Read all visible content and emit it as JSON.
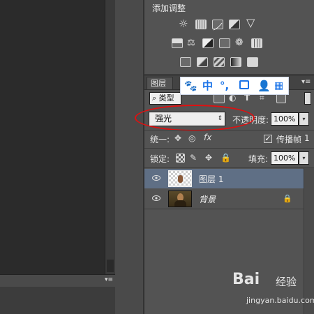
{
  "adjustments": {
    "title": "添加调整",
    "icons": [
      "brightness-contrast-icon",
      "levels-icon",
      "curves-icon",
      "exposure-icon",
      "vibrance-icon",
      "hue-saturation-icon",
      "color-balance-icon",
      "black-white-icon",
      "photo-filter-icon",
      "channel-mixer-icon",
      "color-lookup-icon",
      "invert-icon",
      "posterize-icon",
      "threshold-icon",
      "gradient-map-icon",
      "selective-color-icon"
    ]
  },
  "layers_panel": {
    "tab_label": "图层",
    "filter_label": "类型",
    "blend_mode": "强光",
    "opacity_label": "不透明度:",
    "opacity_value": "100%",
    "unify_label": "统一:",
    "propagate_label": "传播帧",
    "frame_number": "1",
    "lock_label": "锁定:",
    "fill_label": "填充:",
    "fill_value": "100%",
    "layers": [
      {
        "name": "图层 1",
        "selected": true
      },
      {
        "name": "背景",
        "selected": false
      }
    ]
  },
  "ime_toolbar": {
    "icons": [
      "paw-icon",
      "chinese-mode-icon",
      "punctuation-icon",
      "toolbox-icon",
      "user-icon",
      "grid-icon"
    ],
    "mode_label": "中",
    "punct_label": "°,"
  },
  "watermark": {
    "logo": "Bai",
    "text": "经验",
    "url": "jingyan.baidu.com"
  },
  "colors": {
    "panel_bg": "#535353",
    "selected_layer": "#5f6f85",
    "annotation_red": "#e01010",
    "ime_blue": "#1a73e8"
  }
}
